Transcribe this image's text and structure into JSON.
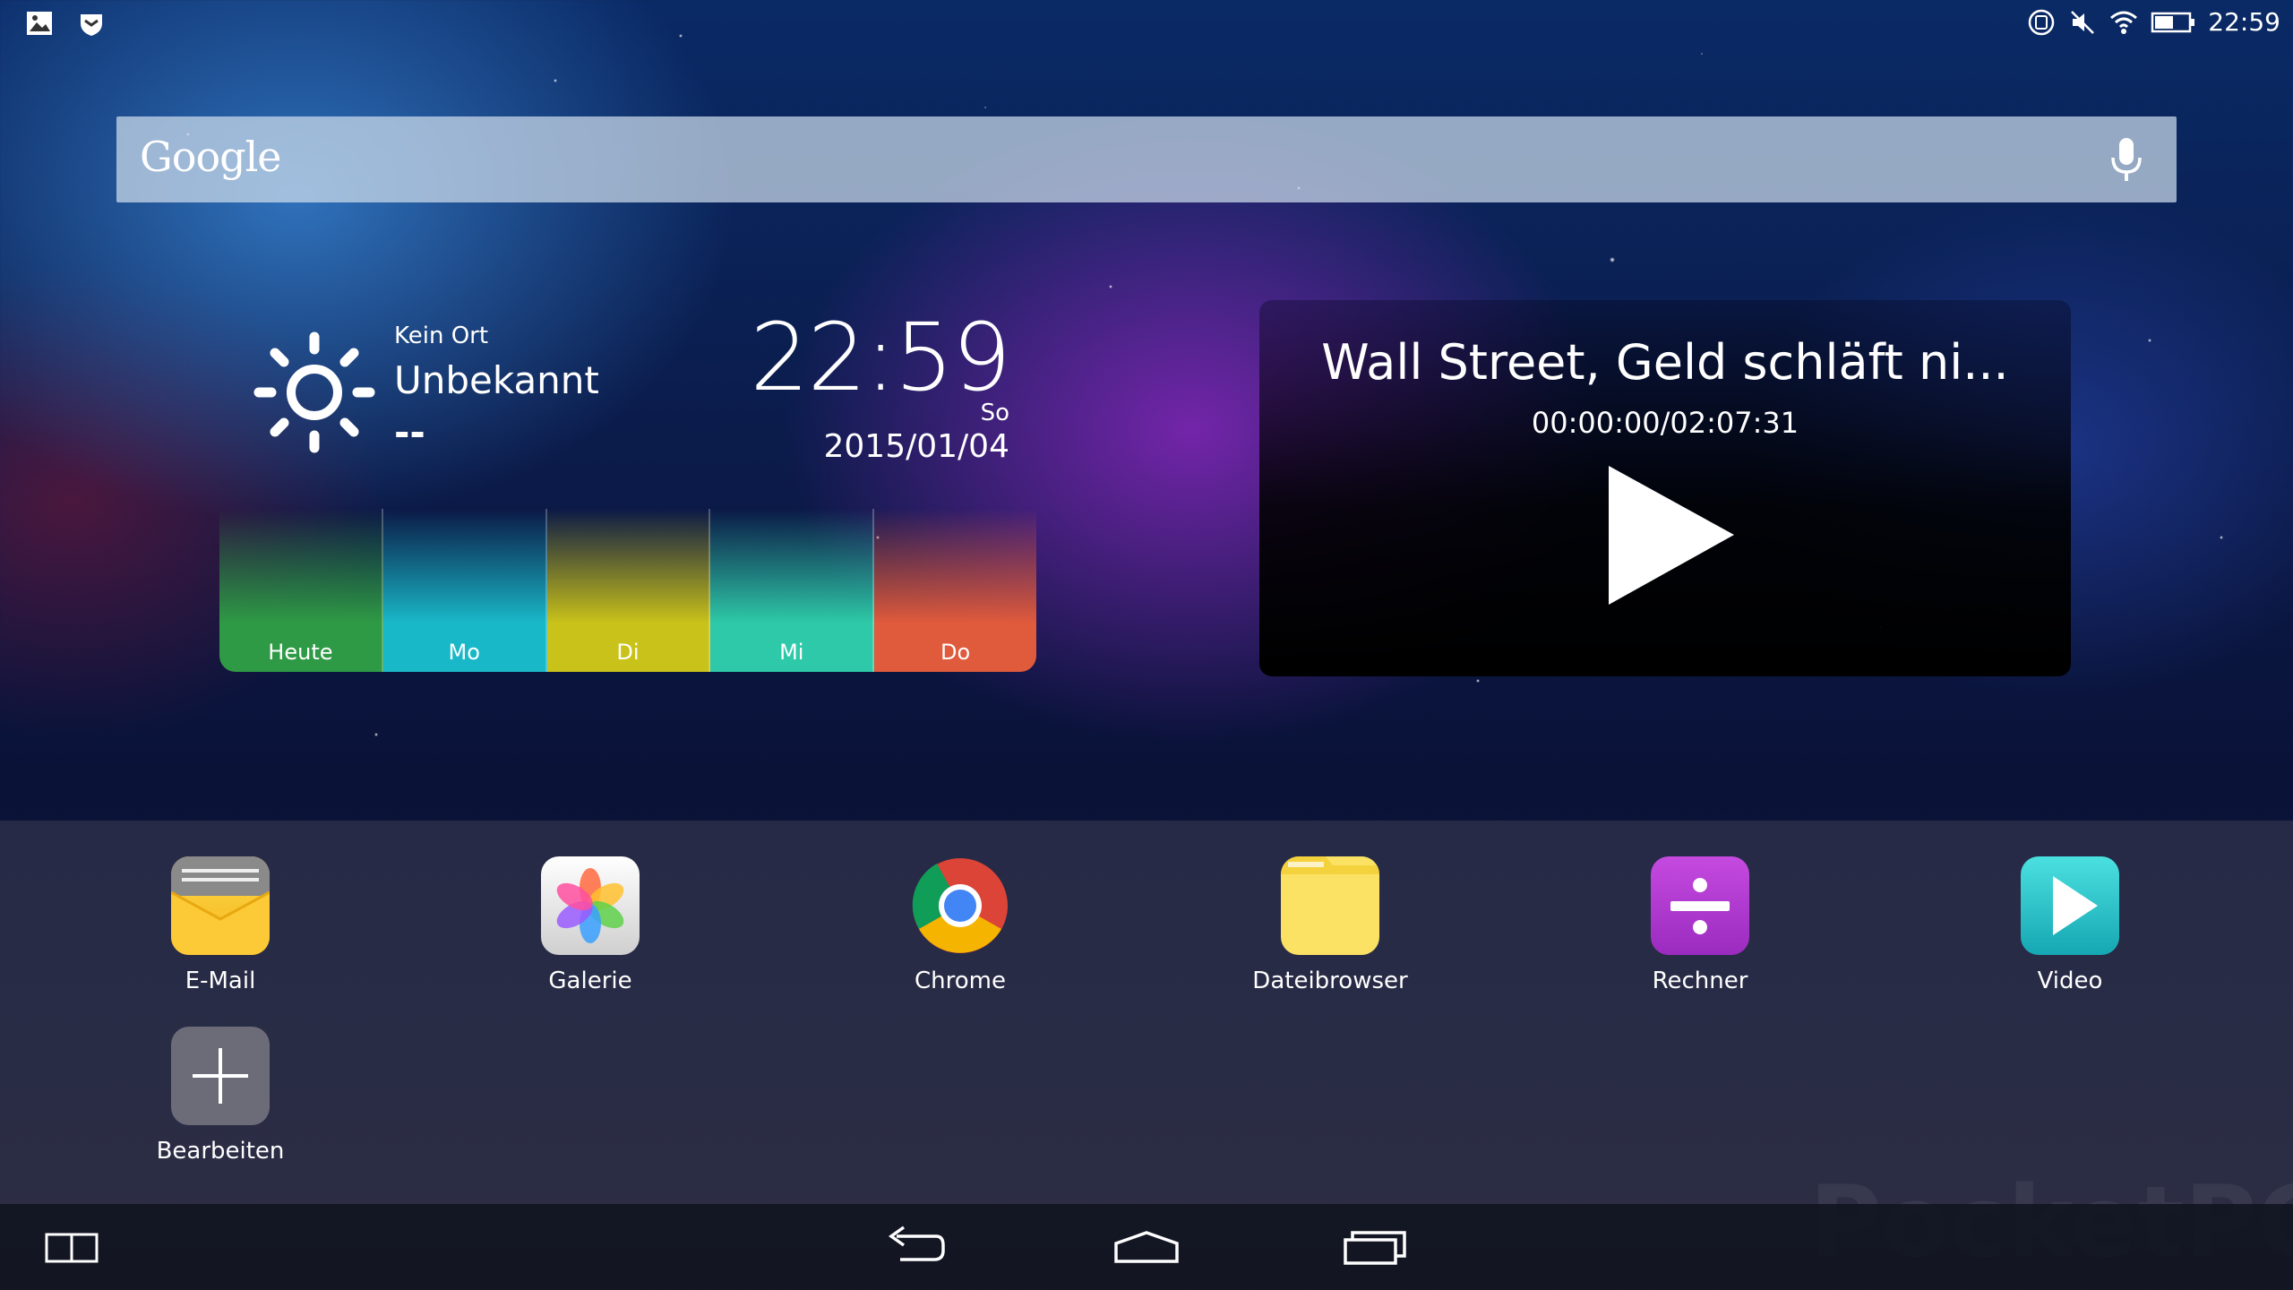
{
  "status_bar": {
    "time": "22:59",
    "icons": [
      "gallery-notification-icon",
      "shield-notification-icon",
      "vibrate-icon",
      "mute-icon",
      "wifi-icon",
      "battery-icon"
    ]
  },
  "search": {
    "logo_text": "Google",
    "mic_icon": "mic-icon"
  },
  "weather": {
    "location": "Kein Ort",
    "condition": "Unbekannt",
    "temperature": "--",
    "clock_time": "22:59",
    "weekday": "So",
    "date": "2015/01/04",
    "forecast": [
      {
        "label": "Heute",
        "color": "#2f9a45"
      },
      {
        "label": "Mo",
        "color": "#19b8c8"
      },
      {
        "label": "Di",
        "color": "#c9c21a"
      },
      {
        "label": "Mi",
        "color": "#2ec9a8"
      },
      {
        "label": "Do",
        "color": "#e05a3c"
      }
    ]
  },
  "video": {
    "title": "Wall Street, Geld schläft ni...",
    "progress": "00:00:00/02:07:31"
  },
  "apps": [
    {
      "label": "E-Mail",
      "icon": "email-icon"
    },
    {
      "label": "Galerie",
      "icon": "gallery-icon"
    },
    {
      "label": "Chrome",
      "icon": "chrome-icon"
    },
    {
      "label": "Dateibrowser",
      "icon": "folder-icon"
    },
    {
      "label": "Rechner",
      "icon": "calculator-icon"
    },
    {
      "label": "Video",
      "icon": "video-icon"
    },
    {
      "label": "Bearbeiten",
      "icon": "plus-icon"
    }
  ],
  "navigation": {
    "buttons": [
      "split-screen-icon",
      "back-icon",
      "home-icon",
      "recents-icon"
    ]
  },
  "watermark": "PocketPC.ch"
}
